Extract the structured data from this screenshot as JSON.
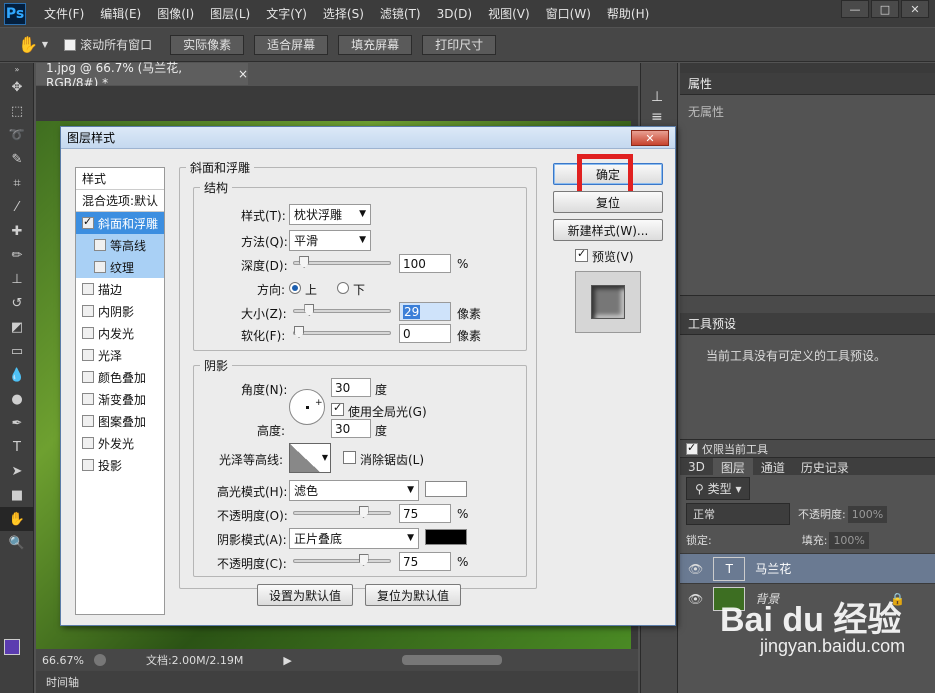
{
  "app": {
    "logo": "Ps"
  },
  "menu": [
    "文件(F)",
    "编辑(E)",
    "图像(I)",
    "图层(L)",
    "文字(Y)",
    "选择(S)",
    "滤镜(T)",
    "3D(D)",
    "视图(V)",
    "窗口(W)",
    "帮助(H)"
  ],
  "winctl": {
    "min": "—",
    "max": "□",
    "close": "✕"
  },
  "options": {
    "scroll_all": "滚动所有窗口",
    "actual": "实际像素",
    "fit": "适合屏幕",
    "fill": "填充屏幕",
    "print": "打印尺寸"
  },
  "document": {
    "tab": "1.jpg @ 66.7% (马兰花, RGB/8#) *",
    "close": "×",
    "zoom": "66.67%",
    "doc_info": "文档:2.00M/2.19M",
    "timeline": "时间轴"
  },
  "properties": {
    "title": "属性",
    "empty": "无属性"
  },
  "tool_presets": {
    "title": "工具预设",
    "empty": "当前工具没有可定义的工具预设。",
    "current_only": "仅限当前工具"
  },
  "layers_panel": {
    "tabs": [
      "3D",
      "图层",
      "通道",
      "历史记录"
    ],
    "kind": "类型",
    "blend": "正常",
    "opacity_label": "不透明度:",
    "opacity": "100%",
    "lock_label": "锁定:",
    "fill_label": "填充:",
    "fill": "100%",
    "layers": [
      {
        "name": "马兰花",
        "thumb": "T"
      },
      {
        "name": "背景"
      }
    ]
  },
  "dialog": {
    "title": "图层样式",
    "close": "✕",
    "styles_header": "样式",
    "blend_options": "混合选项:默认",
    "items": [
      {
        "label": "斜面和浮雕",
        "checked": true,
        "selected": true
      },
      {
        "label": "等高线",
        "checked": false,
        "sub": true
      },
      {
        "label": "纹理",
        "checked": false,
        "sub": true
      },
      {
        "label": "描边",
        "checked": false
      },
      {
        "label": "内阴影",
        "checked": false
      },
      {
        "label": "内发光",
        "checked": false
      },
      {
        "label": "光泽",
        "checked": false
      },
      {
        "label": "颜色叠加",
        "checked": false
      },
      {
        "label": "渐变叠加",
        "checked": false
      },
      {
        "label": "图案叠加",
        "checked": false
      },
      {
        "label": "外发光",
        "checked": false
      },
      {
        "label": "投影",
        "checked": false
      }
    ],
    "bevel": {
      "legend": "斜面和浮雕",
      "structure": "结构",
      "style_label": "样式(T):",
      "style": "枕状浮雕",
      "technique_label": "方法(Q):",
      "technique": "平滑",
      "depth_label": "深度(D):",
      "depth": "100",
      "depth_unit": "%",
      "depth_level": 0.06,
      "direction_label": "方向:",
      "dir_up": "上",
      "dir_down": "下",
      "size_label": "大小(Z):",
      "size": "29",
      "size_unit": "像素",
      "size_level": 0.12,
      "soften_label": "软化(F):",
      "soften": "0",
      "soften_unit": "像素",
      "soften_level": 0.0
    },
    "shading": {
      "legend": "阴影",
      "angle_label": "角度(N):",
      "angle": "30",
      "angle_unit": "度",
      "global_light": "使用全局光(G)",
      "altitude_label": "高度:",
      "altitude": "30",
      "altitude_unit": "度",
      "gloss_label": "光泽等高线:",
      "antialias": "消除锯齿(L)",
      "highlight_mode_label": "高光模式(H):",
      "highlight_mode": "滤色",
      "highlight_color": "#ffffff",
      "hl_opacity_label": "不透明度(O):",
      "hl_opacity": "75",
      "hl_opacity_unit": "%",
      "hl_opacity_level": 0.75,
      "shadow_mode_label": "阴影模式(A):",
      "shadow_mode": "正片叠底",
      "shadow_color": "#000000",
      "sh_opacity_label": "不透明度(C):",
      "sh_opacity": "75",
      "sh_opacity_unit": "%",
      "sh_opacity_level": 0.75
    },
    "make_default": "设置为默认值",
    "reset_default": "复位为默认值",
    "ok": "确定",
    "reset": "复位",
    "new_style": "新建样式(W)...",
    "preview": "预览(V)"
  },
  "watermark": {
    "brand": "Bai du 经验",
    "url": "jingyan.baidu.com"
  }
}
